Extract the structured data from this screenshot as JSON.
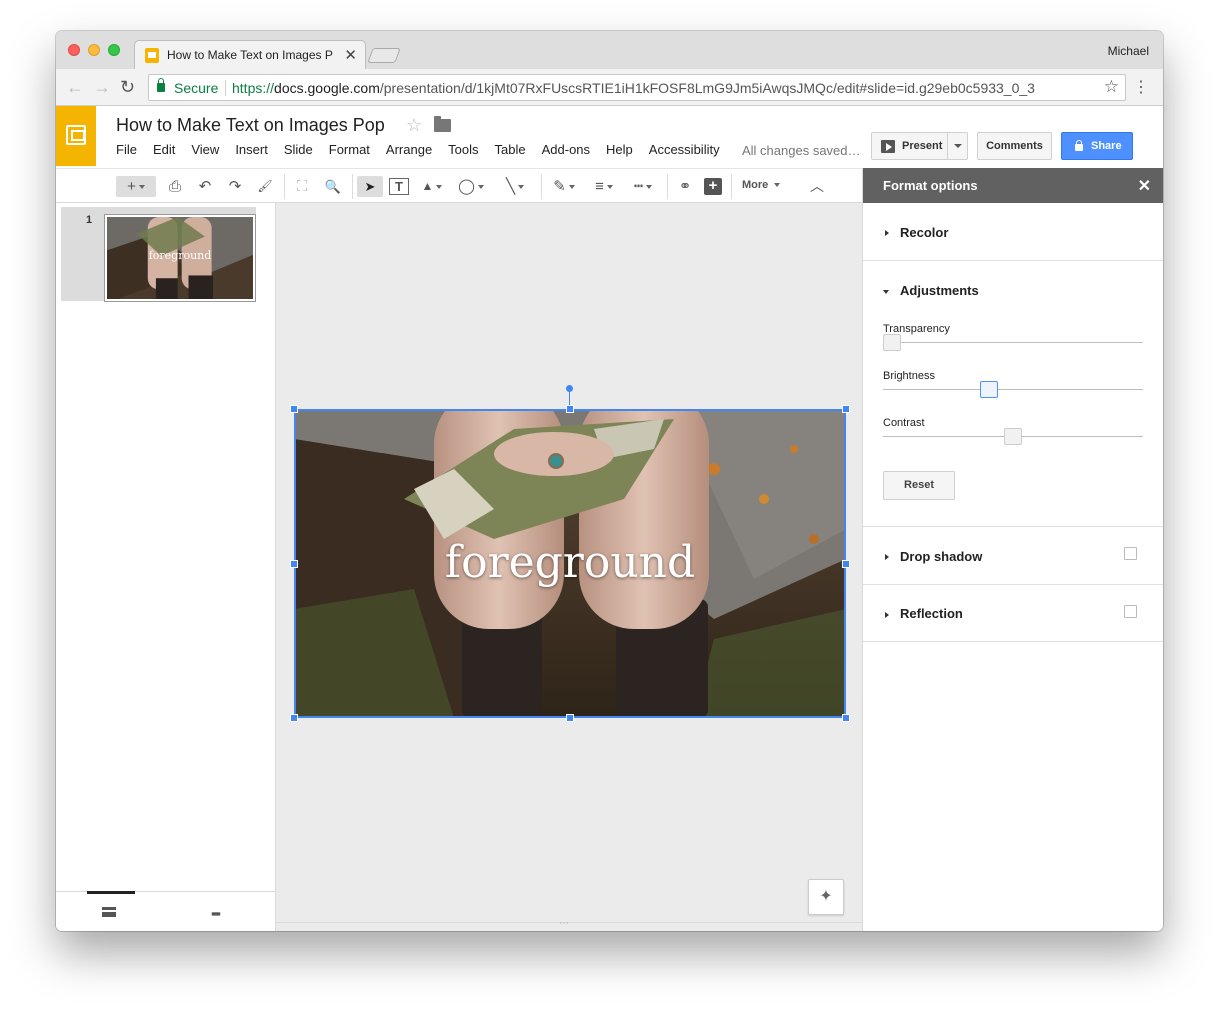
{
  "browser": {
    "tab_title": "How to Make Text on Images P",
    "tab_close": "✕",
    "user": "Michael",
    "secure_label": "Secure",
    "url_scheme": "https://",
    "url_host": "docs.google.com",
    "url_path": "/presentation/d/1kjMt07RxFUscsRTIE1iH1kFOSF8LmG9Jm5iAwqsJMQc/edit#slide=id.g29eb0c5933_0_3",
    "back": "←",
    "forward": "→",
    "reload": "↻",
    "star": "☆",
    "menu": "⋮"
  },
  "app": {
    "doc_title": "How to Make Text on Images Pop",
    "title_star": "☆",
    "menu": [
      "File",
      "Edit",
      "View",
      "Insert",
      "Slide",
      "Format",
      "Arrange",
      "Tools",
      "Table",
      "Add-ons",
      "Help",
      "Accessibility"
    ],
    "save_status": "All changes saved…",
    "present_label": "Present",
    "comments_label": "Comments",
    "share_label": "Share"
  },
  "toolbar": {
    "new_slide": "+",
    "print": "⎙",
    "undo": "↶",
    "redo": "↷",
    "paint_format": "🖌",
    "zoom_fit": "⛶",
    "zoom": "🔍",
    "select": "➤",
    "textbox": "T",
    "image": "▲",
    "shape": "◯",
    "line": "╲",
    "pen": "✎",
    "line_weight": "≡",
    "line_dash": "┅",
    "link": "⚭",
    "comment": "+",
    "more_label": "More",
    "collapse": "︿"
  },
  "filmstrip": {
    "slides": [
      {
        "number": "1",
        "text": "foreground"
      }
    ],
    "grid_icon": "▪▪▪"
  },
  "slide": {
    "text": "foreground"
  },
  "format_panel": {
    "title": "Format options",
    "close": "✕",
    "sections": {
      "recolor": "Recolor",
      "adjustments": "Adjustments",
      "drop_shadow": "Drop shadow",
      "reflection": "Reflection"
    },
    "transparency_label": "Transparency",
    "transparency_value": 0,
    "brightness_label": "Brightness",
    "brightness_value": 0.4,
    "contrast_label": "Contrast",
    "contrast_value": 0.5,
    "reset_label": "Reset",
    "drop_shadow_checked": false,
    "reflection_checked": false
  },
  "colors": {
    "accent": "#4285f4",
    "slides_brand": "#f4b400",
    "share_blue": "#4d90fe",
    "secure_green": "#0b8043"
  },
  "canvas_grip": "⋯"
}
